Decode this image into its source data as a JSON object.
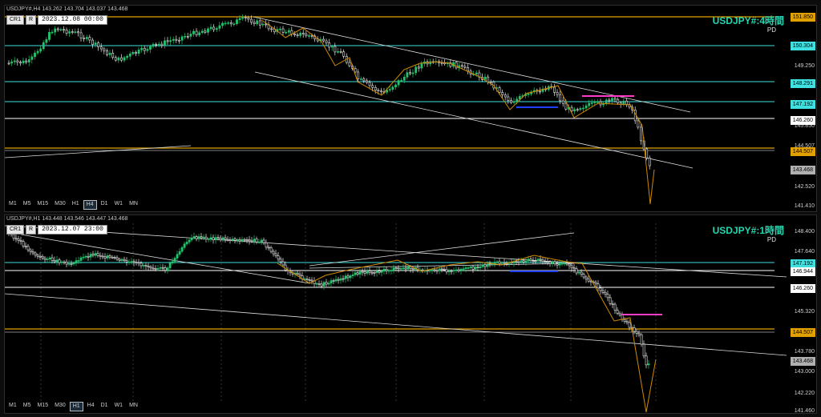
{
  "panels": [
    {
      "symbol_header": "USDJPY#,H4  143.262 143.704 143.037 143.468",
      "cr_label": "CR1",
      "r_label": "R",
      "datetime": "2023.12.08 00:00",
      "title": "USDJPY#:4時間",
      "pd": "PD",
      "timeframes": [
        "M1",
        "M5",
        "M15",
        "M30",
        "H1",
        "H4",
        "D1",
        "W1",
        "MN"
      ],
      "active_timeframe": "H4",
      "price_labels": [
        "151.850",
        "150.304",
        "149.250",
        "148.291",
        "147.192",
        "146.260",
        "145.850",
        "144.507",
        "143.468",
        "142.520",
        "141.410"
      ],
      "tags": [
        {
          "text": "151.850",
          "color": "#e0a000"
        },
        {
          "text": "150.304",
          "color": "#40e0e0"
        },
        {
          "text": "148.291",
          "color": "#40e0e0"
        },
        {
          "text": "147.192",
          "color": "#40e0e0"
        },
        {
          "text": "146.260",
          "color": "#ffffff"
        },
        {
          "text": "144.507",
          "color": "#e0a000"
        },
        {
          "text": "143.468",
          "color": "#b0b0b0"
        }
      ]
    },
    {
      "symbol_header": "USDJPY#,H1  143.448 143.546 143.447 143.468",
      "cr_label": "CR1",
      "r_label": "R",
      "datetime": "2023.12.07 23:00",
      "title": "USDJPY#:1時間",
      "pd": "PD",
      "timeframes": [
        "M1",
        "M5",
        "M15",
        "M30",
        "H1",
        "H4",
        "D1",
        "W1",
        "MN"
      ],
      "active_timeframe": "H1",
      "price_labels": [
        "148.400",
        "147.640",
        "146.944",
        "146.260",
        "145.320",
        "144.507",
        "143.780",
        "143.000",
        "142.220",
        "141.460"
      ],
      "tags": [
        {
          "text": "147.192",
          "color": "#40e0e0"
        },
        {
          "text": "146.944",
          "color": "#ffffff"
        },
        {
          "text": "146.260",
          "color": "#ffffff"
        },
        {
          "text": "144.507",
          "color": "#e0a000"
        },
        {
          "text": "143.468",
          "color": "#b0b0b0"
        }
      ]
    }
  ],
  "colors": {
    "bull": "#22c36a",
    "bear": "#e8e8e8",
    "cyan": "#40e0e0",
    "orange": "#e0a000",
    "magenta": "#ff3cc8",
    "blue": "#2040ff",
    "zigzag": "#d08a00"
  }
}
